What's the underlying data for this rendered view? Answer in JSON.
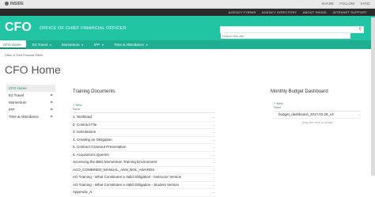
{
  "topbar": {
    "brand": "INSIDE",
    "actions": [
      "SHARE",
      "FOLLOW",
      "SYNC"
    ]
  },
  "links": [
    "AGENCY FORMS",
    "AGENCY DIRECTORY",
    "ABOUT INSIDE",
    "INTRANET SUPPORT"
  ],
  "header": {
    "logo": "CFO",
    "office": "OFFICE OF CHIEF FINANCIAL OFFICER",
    "search_placeholder": "Search this site"
  },
  "nav": {
    "tabs": [
      "CFO Home",
      "E2 Travel",
      "Momentum",
      "IPP",
      "Time & Attendance"
    ]
  },
  "breadcrumb": "Office of Chief Financial Officer",
  "page_title": "CFO Home",
  "leftnav": {
    "items": [
      "CFO Home",
      "E2 Travel",
      "Momentum",
      "IPP",
      "Time & Attendance"
    ]
  },
  "training": {
    "title": "Training Documents",
    "new_label": "New",
    "column": "Name",
    "docs": [
      "1. Workload",
      "2. Contract File",
      "3. Solicitations",
      "4. Creating an Obligation",
      "5. Contract Closeout Presentation",
      "6. Acquisitions Queries",
      "Accessing the BBG Momentum Training Environment",
      "ACO_COMBINED_MANUAL_ANN_BOL_AWARDS",
      "AO Training - What Constitutes a Valid Obligation - Instructor Version",
      "AO Training - What Constitutes a Valid Obligation - Student Version",
      "Appendix_A"
    ],
    "ellipsis": "..."
  },
  "budget": {
    "title": "Monthly Budget Dashboard",
    "new_label": "New",
    "column": "Name",
    "file": "budget_dashboard_2017.02.28_v4",
    "drop_text": "Drag files here to upload"
  }
}
